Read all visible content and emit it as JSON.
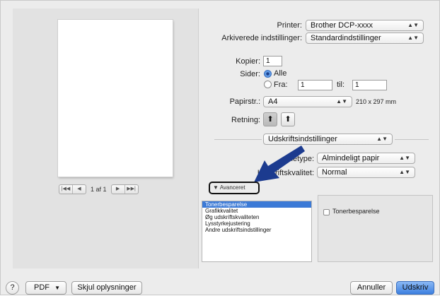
{
  "printer": {
    "label": "Printer:",
    "value": "Brother DCP-xxxx"
  },
  "presets": {
    "label": "Arkiverede indstillinger:",
    "value": "Standardindstillinger"
  },
  "copies": {
    "label": "Kopier:",
    "value": "1"
  },
  "pages": {
    "label": "Sider:",
    "all_label": "Alle",
    "from_label": "Fra:",
    "from_value": "1",
    "to_label": "til:",
    "to_value": "1"
  },
  "paper_size": {
    "label": "Papirstr.:",
    "value": "A4",
    "dimensions": "210 x 297 mm"
  },
  "orientation": {
    "label": "Retning:"
  },
  "section_popup": {
    "value": "Udskriftsindstillinger"
  },
  "media_type": {
    "label_visible": "dietype:",
    "value": "Almindeligt papir"
  },
  "print_quality": {
    "label_visible": "Udskriftskvalitet:",
    "value": "Normal"
  },
  "advanced": {
    "label": "Avanceret"
  },
  "advanced_list": {
    "items": [
      "Tonerbesparelse",
      "Grafikkvalitet",
      "Øg udskriftskvaliteten",
      "Lysstyrkejustering",
      "Andre udskriftsindstillinger"
    ],
    "selected_index": 0
  },
  "toner_saving": {
    "label": "Tonerbesparelse"
  },
  "pager": {
    "page_text": "1 af 1"
  },
  "footer": {
    "help": "?",
    "pdf_label": "PDF",
    "hide_details_label": "Skjul oplysninger",
    "cancel_label": "Annuller",
    "print_label": "Udskriv"
  },
  "colors": {
    "accent": "#3c7ad6",
    "annotation": "#1c3b8f"
  }
}
